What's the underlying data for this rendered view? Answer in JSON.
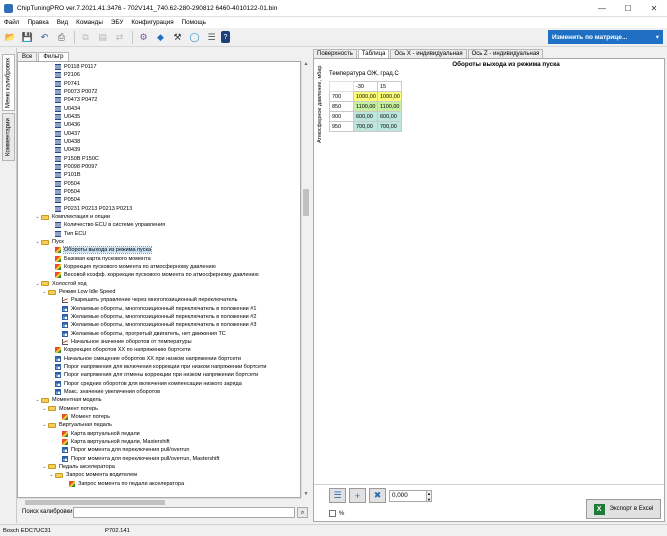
{
  "window": {
    "title": "ChipTuningPRO ver.7.2021.41.3476 - 702V141_740.62-280-290812 6460-4010122-01.bin",
    "controls": [
      "—",
      "☐",
      "✕"
    ]
  },
  "menu": [
    "Файл",
    "Правка",
    "Вид",
    "Команды",
    "ЭБУ",
    "Конфигурация",
    "Помощь"
  ],
  "toolbar": {
    "icons": [
      "open-folder-icon",
      "save-icon",
      "undo-icon",
      "print-icon",
      "copy-icon",
      "paste-icon",
      "compare-icon",
      "chip-icon",
      "find-icon",
      "wrench-icon",
      "globe-icon",
      "settings-icon",
      "help-icon"
    ],
    "matrix_button": "Изменить по матрице...",
    "matrix_arrow": "▾"
  },
  "side_tabs": [
    "Меню калибровок",
    "Комментарии"
  ],
  "tree": {
    "header_tabs": [
      "Все",
      "Фильтр"
    ],
    "rows": [
      {
        "indent": 4,
        "icon": "dtc",
        "label": "P0118 P0117"
      },
      {
        "indent": 4,
        "icon": "dtc",
        "label": "P2106"
      },
      {
        "indent": 4,
        "icon": "dtc",
        "label": "P0741"
      },
      {
        "indent": 4,
        "icon": "dtc",
        "label": "P0073 P0072"
      },
      {
        "indent": 4,
        "icon": "dtc",
        "label": "P0473 P0472"
      },
      {
        "indent": 4,
        "icon": "dtc",
        "label": "U0434"
      },
      {
        "indent": 4,
        "icon": "dtc",
        "label": "U0435"
      },
      {
        "indent": 4,
        "icon": "dtc",
        "label": "U0436"
      },
      {
        "indent": 4,
        "icon": "dtc",
        "label": "U0437"
      },
      {
        "indent": 4,
        "icon": "dtc",
        "label": "U0438"
      },
      {
        "indent": 4,
        "icon": "dtc",
        "label": "U0439"
      },
      {
        "indent": 4,
        "icon": "dtc",
        "label": "P150B P150C"
      },
      {
        "indent": 4,
        "icon": "dtc",
        "label": "P0098 P0097"
      },
      {
        "indent": 4,
        "icon": "dtc",
        "label": "P101B"
      },
      {
        "indent": 4,
        "icon": "dtc",
        "label": "P0504"
      },
      {
        "indent": 4,
        "icon": "dtc",
        "label": "P0504"
      },
      {
        "indent": 4,
        "icon": "dtc",
        "label": "P0504"
      },
      {
        "indent": 4,
        "icon": "dtc",
        "label": "P0231 P0213 P0213 P0213"
      },
      {
        "indent": 2,
        "icon": "folder",
        "exp": "⌄",
        "label": "Комплектация и опции"
      },
      {
        "indent": 4,
        "icon": "dtc",
        "label": "Количество ECU в системе управления"
      },
      {
        "indent": 4,
        "icon": "dtc",
        "label": "Тип ECU"
      },
      {
        "indent": 2,
        "icon": "folder",
        "exp": "⌄",
        "label": "Пуск"
      },
      {
        "indent": 4,
        "icon": "map",
        "label": "Обороты выхода из режима пуска",
        "selected": true
      },
      {
        "indent": 4,
        "icon": "map",
        "label": "Базовая карта пускового момента"
      },
      {
        "indent": 4,
        "icon": "map",
        "label": "Коррекция пускового момента по атмосферному давлению"
      },
      {
        "indent": 4,
        "icon": "map",
        "label": "Весовой коэфф. коррекции пускового момента по атмосферному давлению"
      },
      {
        "indent": 2,
        "icon": "folder",
        "exp": "⌄",
        "label": "Холостой ход"
      },
      {
        "indent": 3,
        "icon": "folder",
        "exp": "⌄",
        "label": "Режим Low Idle Speed"
      },
      {
        "indent": 5,
        "icon": "graph",
        "label": "Разрешить управление через многопозиционный переключатель"
      },
      {
        "indent": 5,
        "icon": "table",
        "label": "Желаемые обороты, многопозиционный переключатель в положении #1"
      },
      {
        "indent": 5,
        "icon": "table",
        "label": "Желаемые обороты, многопозиционный переключатель в положении #2"
      },
      {
        "indent": 5,
        "icon": "table",
        "label": "Желаемые обороты, многопозиционный переключатель в положении #3"
      },
      {
        "indent": 5,
        "icon": "table",
        "label": "Желаемые обороты, прогретый двигатель, нет движения ТС"
      },
      {
        "indent": 5,
        "icon": "graph",
        "label": "Начальное значение оборотов от температуры"
      },
      {
        "indent": 4,
        "icon": "map",
        "label": "Коррекция оборотов XX по напряжению бортсети"
      },
      {
        "indent": 4,
        "icon": "table",
        "label": "Начальное смещение оборотов XX при низком напряжении бортсети"
      },
      {
        "indent": 4,
        "icon": "table",
        "label": "Порог напряжения для включения коррекции при низком напряжении бортсети"
      },
      {
        "indent": 4,
        "icon": "table",
        "label": "Порог напряжения для отмены коррекции при низком напряжении бортсети"
      },
      {
        "indent": 4,
        "icon": "table",
        "label": "Порог средних оборотов для включения компенсации низкого заряда"
      },
      {
        "indent": 4,
        "icon": "table",
        "label": "Макс. значение увеличения оборотов"
      },
      {
        "indent": 2,
        "icon": "folder",
        "exp": "⌄",
        "label": "Моментная модель"
      },
      {
        "indent": 3,
        "icon": "folder",
        "exp": "⌄",
        "label": "Момент потерь"
      },
      {
        "indent": 5,
        "icon": "map",
        "label": "Момент потерь"
      },
      {
        "indent": 3,
        "icon": "folder",
        "exp": "⌄",
        "label": "Виртуальная педаль"
      },
      {
        "indent": 5,
        "icon": "map",
        "label": "Карта виртуальной педали"
      },
      {
        "indent": 5,
        "icon": "map",
        "label": "Карта виртуальной педали, Mastershift"
      },
      {
        "indent": 5,
        "icon": "table",
        "label": "Порог момента для переключения pull/overrun"
      },
      {
        "indent": 5,
        "icon": "table",
        "label": "Порог момента для переключения pull/overrun, Mastershift"
      },
      {
        "indent": 3,
        "icon": "folder",
        "exp": "⌄",
        "label": "Педаль акселератора"
      },
      {
        "indent": 4,
        "icon": "folder",
        "exp": "⌄",
        "label": "Запрос момента водителем"
      },
      {
        "indent": 6,
        "icon": "map",
        "label": "Запрос момента по педали акселератора"
      }
    ]
  },
  "search": {
    "label": "Поиск калибровки",
    "value": "",
    "button": "⌕"
  },
  "tabs": [
    "Поверхность",
    "Таблица",
    "Ось X - индивидуальная",
    "Ось Z - индивидуальная"
  ],
  "active_tab": "Таблица",
  "map": {
    "title": "Обороты выхода из режима пуска",
    "x_axis_label": "Температура ОЖ, град.С",
    "y_axis_label": "Атмосферное давление, мбар",
    "columns": [
      "-30",
      "15"
    ],
    "rows": [
      {
        "axis": "700",
        "cells": [
          "1000,00",
          "1000,00"
        ],
        "color": "yellow"
      },
      {
        "axis": "850",
        "cells": [
          "1100,00",
          "1100,00"
        ],
        "color": "green"
      },
      {
        "axis": "900",
        "cells": [
          "600,00",
          "600,00"
        ],
        "color": "teal"
      },
      {
        "axis": "950",
        "cells": [
          "700,00",
          "700,00"
        ],
        "color": "teal"
      }
    ]
  },
  "actions": {
    "set_icon": "equals-icon",
    "add_icon": "plus-icon",
    "mult_icon": "multiply-icon",
    "value": "0,000",
    "percent_label": "%",
    "percent_checked": false,
    "export_label": "Экспорт в Excel",
    "export_icon_text": "X"
  },
  "status": {
    "ecu": "Bosch EDC7UC31",
    "version": "P702.141"
  },
  "colors": {
    "yellow": "#ffff7a",
    "green": "#c7f0a0",
    "teal": "#bde6dc",
    "accent": "#1f6fc5"
  }
}
